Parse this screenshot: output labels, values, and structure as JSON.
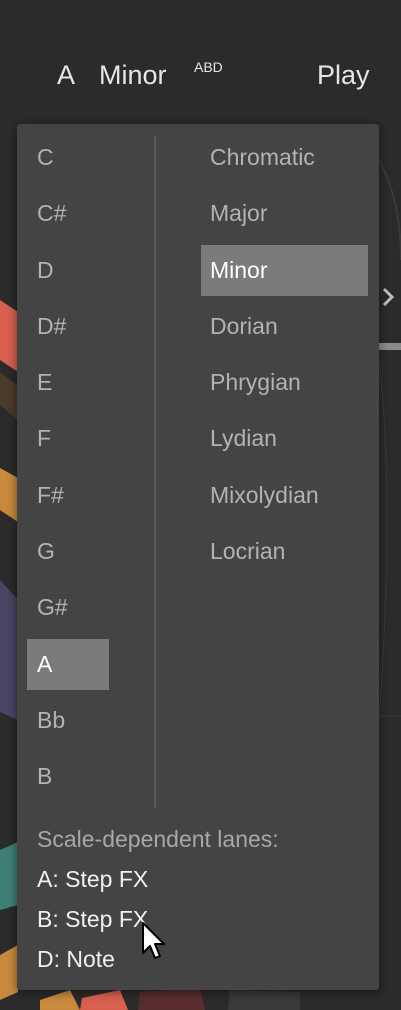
{
  "header": {
    "root": "A",
    "scale": "Minor",
    "superscript": "ABD",
    "play_label": "Play"
  },
  "notes": [
    "C",
    "C#",
    "D",
    "D#",
    "E",
    "F",
    "F#",
    "G",
    "G#",
    "A",
    "Bb",
    "B"
  ],
  "selected_note": "A",
  "scales": [
    "Chromatic",
    "Major",
    "Minor",
    "Dorian",
    "Phrygian",
    "Lydian",
    "Mixolydian",
    "Locrian"
  ],
  "selected_scale": "Minor",
  "lanes": {
    "heading": "Scale-dependent lanes:",
    "items": [
      "A: Step FX",
      "B: Step FX",
      "D: Note"
    ]
  },
  "colors": {
    "panel": "#444444",
    "selected_bg": "#7b7b7b",
    "item_text": "#b3b3b3",
    "wheel_red": "#d9604f",
    "wheel_orange": "#c98a3e",
    "wheel_teal": "#3f8076",
    "wheel_purple": "#4a4565"
  }
}
